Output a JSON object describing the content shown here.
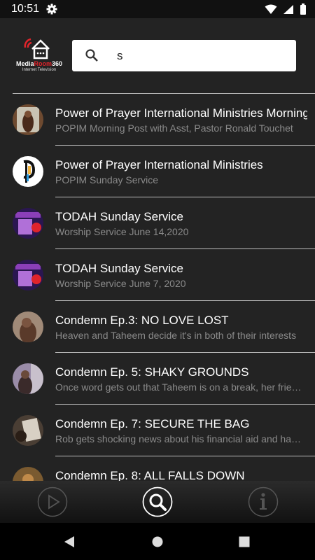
{
  "status": {
    "time": "10:51"
  },
  "logo": {
    "brand_a": "Media",
    "brand_b": "Room",
    "brand_c": "360",
    "tagline": "Internet Television"
  },
  "search": {
    "value": "s",
    "placeholder": ""
  },
  "results": [
    {
      "title": "Power of Prayer International Ministries Morning Post",
      "subtitle": "POPIM Morning Post with Asst, Pastor Ronald Touchet",
      "thumb_color": "#5a3b2a"
    },
    {
      "title": "Power of Prayer International Ministries",
      "subtitle": "POPIM Sunday Service",
      "thumb_color": "#ffffff"
    },
    {
      "title": "TODAH Sunday Service",
      "subtitle": "Worship Service June 14,2020",
      "thumb_color": "#3a1f6e"
    },
    {
      "title": "TODAH Sunday Service",
      "subtitle": "Worship Service June 7, 2020",
      "thumb_color": "#3a1f6e"
    },
    {
      "title": "Condemn Ep.3: NO LOVE LOST",
      "subtitle": "Heaven and Taheem decide it's in both of their interests",
      "thumb_color": "#8a7466"
    },
    {
      "title": "Condemn Ep. 5: SHAKY GROUNDS",
      "subtitle": "Once word gets out that Taheem is on a break, her friends",
      "thumb_color": "#7a6a80"
    },
    {
      "title": "Condemn Ep. 7: SECURE THE BAG",
      "subtitle": "Rob gets shocking news about his financial aid and has to",
      "thumb_color": "#6b5d4e"
    },
    {
      "title": "Condemn Ep. 8: ALL FALLS DOWN",
      "subtitle": "",
      "thumb_color": "#8a6a3a"
    }
  ]
}
